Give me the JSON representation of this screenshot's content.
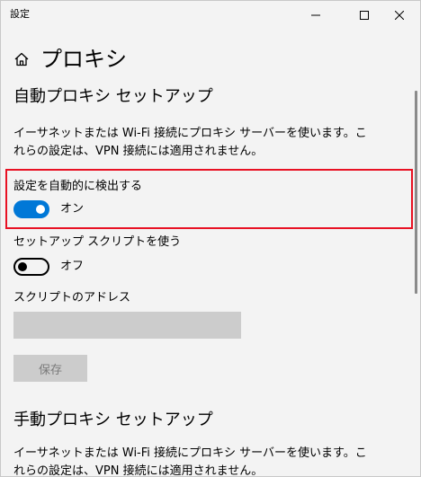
{
  "window": {
    "title": "設定",
    "minimize_icon": "minimize-icon",
    "maximize_icon": "maximize-icon",
    "close_icon": "close-icon"
  },
  "header": {
    "home_icon": "home-icon",
    "title": "プロキシ"
  },
  "auto_section": {
    "heading": "自動プロキシ セットアップ",
    "description": "イーサネットまたは Wi-Fi 接続にプロキシ サーバーを使います。これらの設定は、VPN 接続には適用されません。",
    "auto_detect": {
      "label": "設定を自動的に検出する",
      "state_text": "オン",
      "on": true
    },
    "setup_script": {
      "label": "セットアップ スクリプトを使う",
      "state_text": "オフ",
      "on": false
    },
    "script_address": {
      "label": "スクリプトのアドレス",
      "value": "",
      "placeholder": ""
    },
    "save_label": "保存"
  },
  "manual_section": {
    "heading": "手動プロキシ セットアップ",
    "description": "イーサネットまたは Wi-Fi 接続にプロキシ サーバーを使います。これらの設定は、VPN 接続には適用されません。"
  },
  "colors": {
    "accent": "#0078d7",
    "highlight_border": "#e81123",
    "disabled_fill": "#cccccc",
    "background": "#f3f3f3"
  }
}
